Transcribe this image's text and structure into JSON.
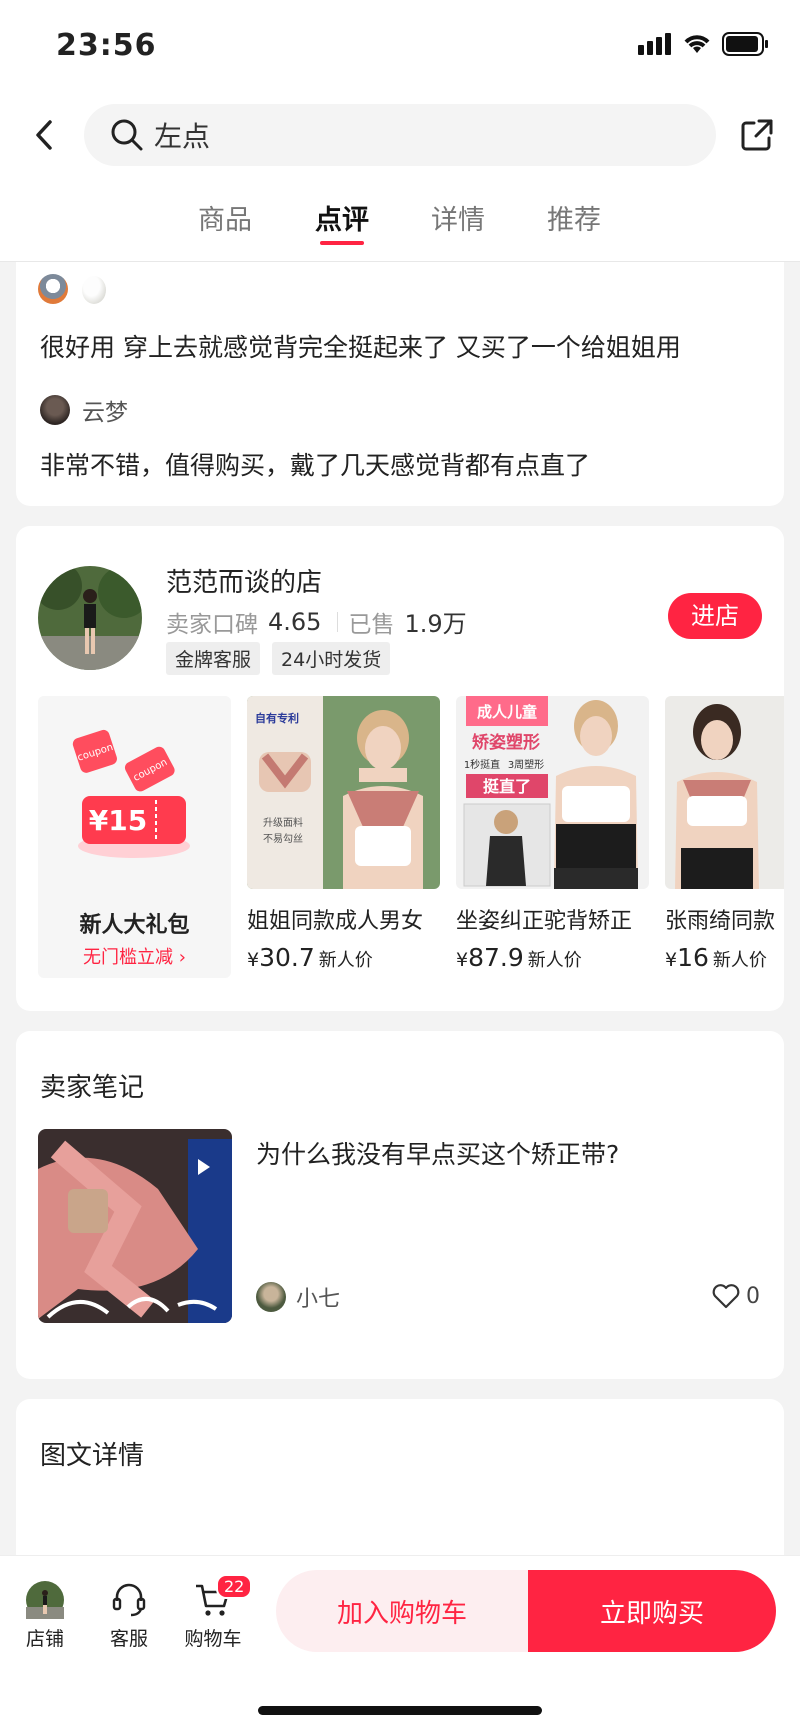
{
  "status_bar": {
    "time": "23:56"
  },
  "search": {
    "value": "左点"
  },
  "tabs": [
    {
      "label": "商品"
    },
    {
      "label": "点评"
    },
    {
      "label": "详情"
    },
    {
      "label": "推荐"
    }
  ],
  "active_tab": "点评",
  "reviews": [
    {
      "text": "很好用 穿上去就感觉背完全挺起来了 又买了一个给姐姐用"
    },
    {
      "user": "云梦",
      "text": "非常不错，值得购买，戴了几天感觉背都有点直了"
    }
  ],
  "shop": {
    "name": "范范而谈的店",
    "rating_label": "卖家口碑",
    "rating": "4.65",
    "sold_label": "已售",
    "sold": "1.9万",
    "tags": [
      "金牌客服",
      "24小时发货"
    ],
    "enter_label": "进店",
    "gift": {
      "coupon": "¥15",
      "title": "新人大礼包",
      "subtitle": "无门槛立减",
      "coupon_word": "coupon"
    },
    "products": [
      {
        "name": "姐姐同款成人男女",
        "currency": "¥",
        "price": "30.7",
        "price_note": "新人价",
        "image_text": [
          "自有专利",
          "升级面料",
          "不易勾丝"
        ]
      },
      {
        "name": "坐姿纠正驼背矫正",
        "currency": "¥",
        "price": "87.9",
        "price_note": "新人价",
        "image_text": [
          "成人儿童",
          "矫姿塑形",
          "1秒挺直",
          "3周塑形",
          "挺直了"
        ]
      },
      {
        "name": "张雨绮同款",
        "currency": "¥",
        "price": "16",
        "price_note": "新人价"
      }
    ]
  },
  "seller_notes": {
    "title": "卖家笔记",
    "items": [
      {
        "title": "为什么我没有早点买这个矫正带?",
        "author": "小七",
        "likes": "0"
      }
    ]
  },
  "detail": {
    "title": "图文详情"
  },
  "bottom_bar": {
    "store_label": "店铺",
    "service_label": "客服",
    "cart_label": "购物车",
    "cart_count": "22",
    "add_to_cart": "加入购物车",
    "buy_now": "立即购买"
  },
  "colors": {
    "accent": "#ff2442",
    "cart_button_bg": "#fdeef0",
    "page_bg": "#f3f3f3"
  }
}
